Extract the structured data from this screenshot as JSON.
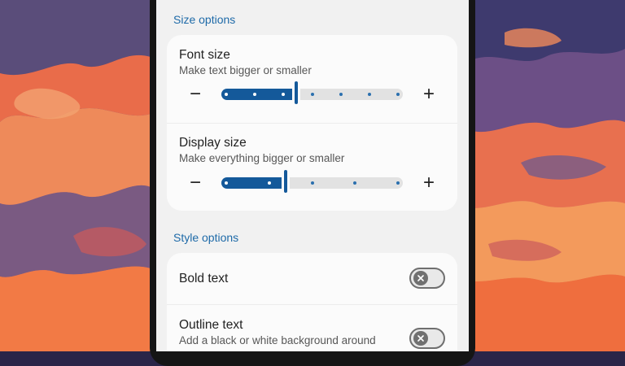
{
  "size_options": {
    "header": "Size options",
    "font_size": {
      "title": "Font size",
      "subtitle": "Make text bigger or smaller",
      "decrease_glyph": "−",
      "increase_glyph": "+",
      "steps": 7,
      "current_step": 2
    },
    "display_size": {
      "title": "Display size",
      "subtitle": "Make everything bigger or smaller",
      "decrease_glyph": "−",
      "increase_glyph": "+",
      "steps": 5,
      "current_step": 1
    }
  },
  "style_options": {
    "header": "Style options",
    "bold_text": {
      "title": "Bold text",
      "enabled": false
    },
    "outline_text": {
      "title": "Outline text",
      "subtitle": "Add a black or white background around",
      "enabled": false
    }
  },
  "colors": {
    "accent": "#14599a",
    "header_text": "#1e6aa8",
    "screen_bg": "#f1f1f1",
    "card_bg": "#fbfbfb"
  },
  "icons": {
    "toggle_off": "close-x-icon"
  }
}
